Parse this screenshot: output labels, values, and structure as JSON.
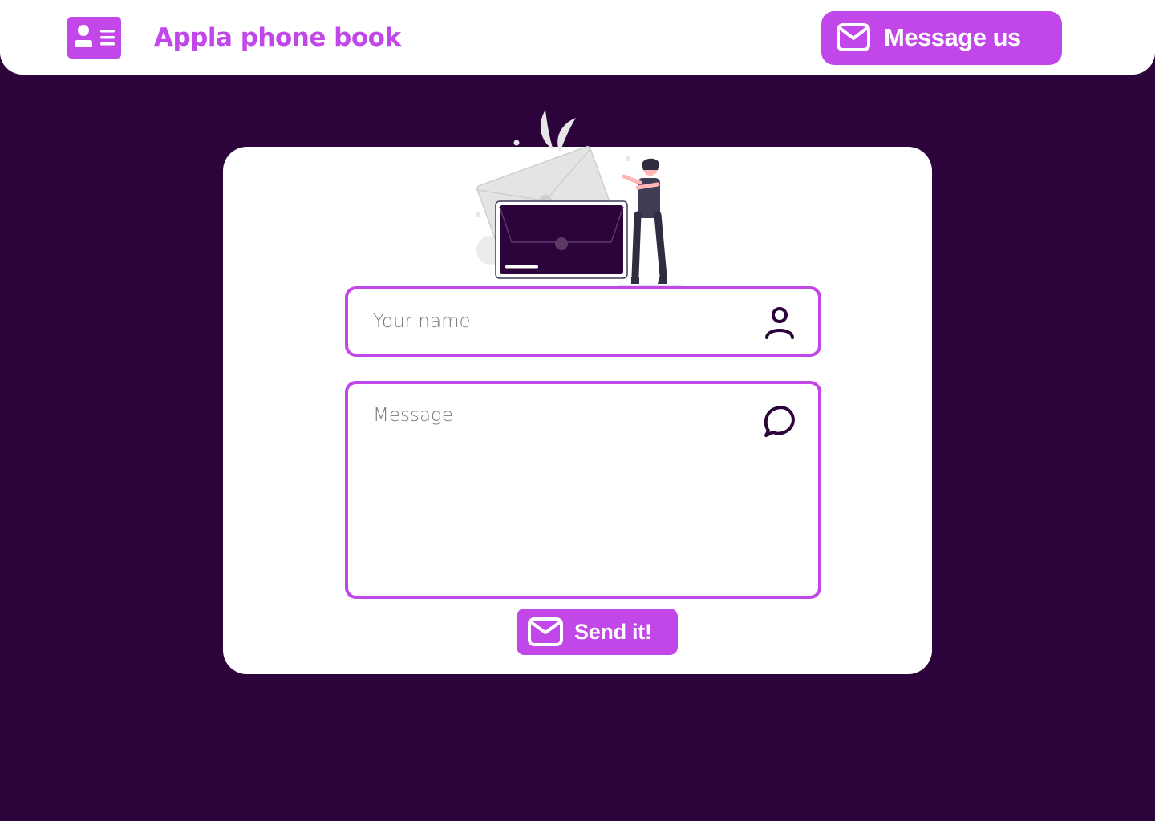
{
  "header": {
    "title": "Appla phone book",
    "logo_icon": "contact-card-icon",
    "message_button_label": "Message us",
    "message_button_icon": "mail-icon"
  },
  "form": {
    "name_placeholder": "Your name",
    "name_icon": "user-icon",
    "message_placeholder": "Message",
    "message_icon": "chat-bubble-icon",
    "submit_label": "Send it!",
    "submit_icon": "mail-icon"
  },
  "colors": {
    "accent": "#c147e9",
    "background": "#2d033b",
    "surface": "#ffffff",
    "icon_dark": "#2d033b"
  }
}
